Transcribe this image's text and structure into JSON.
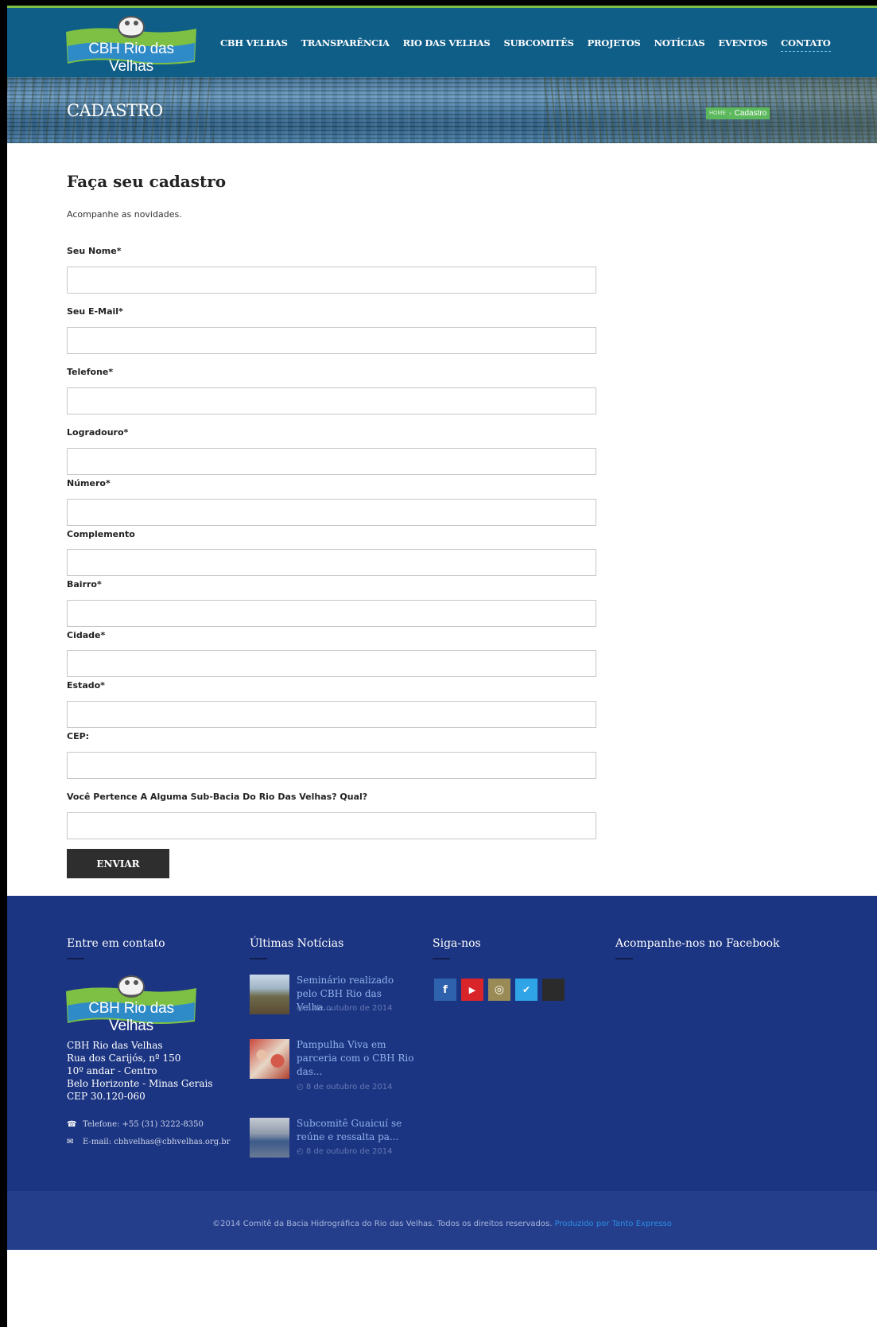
{
  "header": {
    "logo_text": "CBH Rio das Velhas",
    "nav": [
      "CBH VELHAS",
      "TRANSPARÊNCIA",
      "RIO DAS VELHAS",
      "SUBCOMITÊS",
      "PROJETOS",
      "NOTÍCIAS",
      "EVENTOS",
      "CONTATO"
    ],
    "active_nav": "CONTATO"
  },
  "banner": {
    "title": "CADASTRO",
    "breadcrumb_home": "HOME",
    "breadcrumb_sep": "›",
    "breadcrumb_current": "Cadastro"
  },
  "form": {
    "heading": "Faça seu cadastro",
    "intro": "Acompanhe as novidades.",
    "fields": [
      {
        "label": "Seu Nome*",
        "value": ""
      },
      {
        "label": "Seu E-Mail*",
        "value": ""
      },
      {
        "label": "Telefone*",
        "value": ""
      },
      {
        "label": "Logradouro*",
        "value": ""
      },
      {
        "label": "Número*",
        "value": ""
      },
      {
        "label": "Complemento",
        "value": ""
      },
      {
        "label": "Bairro*",
        "value": ""
      },
      {
        "label": "Cidade*",
        "value": ""
      },
      {
        "label": "Estado*",
        "value": ""
      },
      {
        "label": "CEP:",
        "value": ""
      },
      {
        "label": "Você Pertence A Alguma Sub-Bacia Do Rio Das Velhas? Qual?",
        "value": ""
      }
    ],
    "submit_label": "ENVIAR"
  },
  "footer": {
    "contact": {
      "heading": "Entre em contato",
      "logo_text": "CBH Rio das Velhas",
      "address": "CBH Rio das Velhas\nRua dos Carijós, nº 150\n10º andar - Centro\nBelo Horizonte - Minas Gerais\nCEP 30.120-060",
      "phone": "Telefone: +55 (31) 3222-8350",
      "email": "E-mail: cbhvelhas@cbhvelhas.org.br"
    },
    "news": {
      "heading": "Últimas Notícias",
      "items": [
        {
          "title": "Seminário realizado pelo CBH Rio das Velha...",
          "date": "8 de outubro de 2014"
        },
        {
          "title": "Pampulha Viva em parceria com o CBH Rio das...",
          "date": "8 de outubro de 2014"
        },
        {
          "title": "Subcomitê Guaicuí se reúne e ressalta pa...",
          "date": "8 de outubro de 2014"
        }
      ]
    },
    "social": {
      "heading": "Siga-nos",
      "icons": [
        "facebook-icon",
        "youtube-icon",
        "instagram-icon",
        "foursquare-icon",
        "blank-icon"
      ],
      "colors": [
        "#2f62ad",
        "#d9252a",
        "#9a8a55",
        "#2fa4e7",
        "#2b2b2b"
      ]
    },
    "facebook": {
      "heading": "Acompanhe-nos no Facebook"
    },
    "copyright": "©2014 Comitê da Bacia Hidrográfica do Rio das Velhas. Todos os direitos reservados.",
    "credit": "Produzido por Tanto Expresso"
  },
  "colors": {
    "header_bg": "#0f5e88",
    "footer_bg": "#1c3582",
    "breadcrumb_bg": "#5cb85c",
    "button_bg": "#2e2e2e"
  }
}
